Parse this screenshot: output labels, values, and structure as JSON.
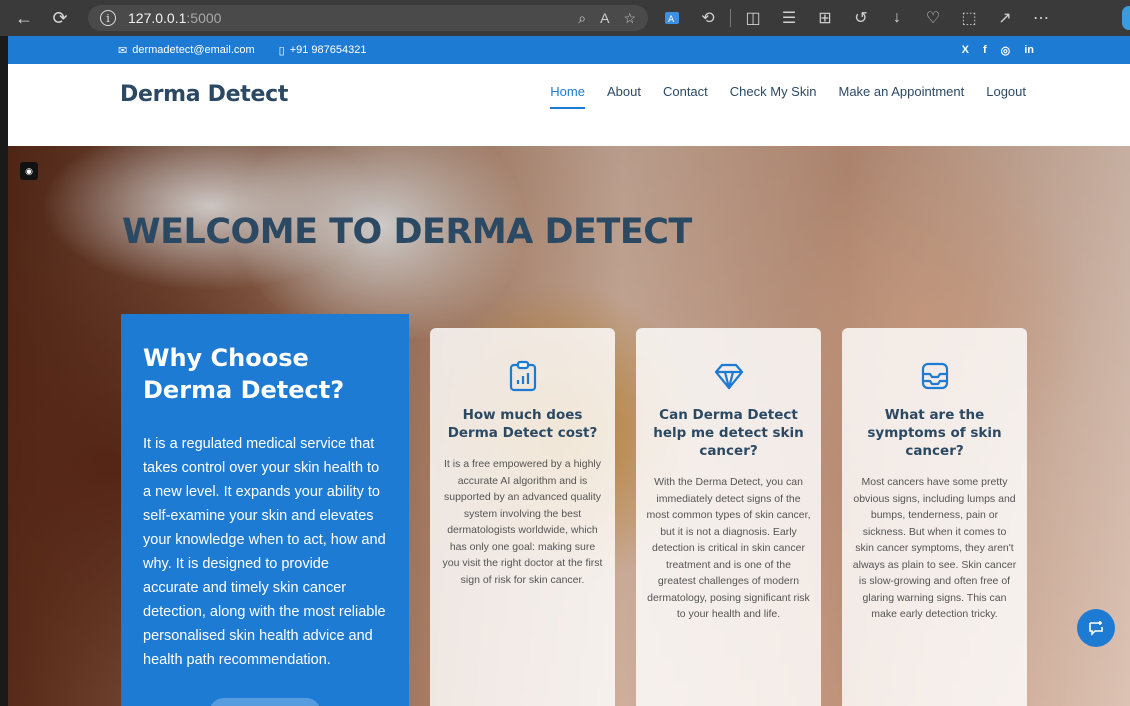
{
  "browser": {
    "url_host": "127.0.0.1",
    "url_port": ":5000",
    "icons": [
      "back-icon",
      "reload-icon",
      "info-icon",
      "zoom-icon",
      "read-aloud-icon",
      "favorite-icon",
      "translate-icon",
      "extensions-icon",
      "split-screen-icon",
      "favorites-bar-icon",
      "collections-icon",
      "history-icon",
      "download-icon",
      "health-icon",
      "screenshot-icon",
      "share-icon",
      "more-icon"
    ]
  },
  "topbar": {
    "email": "dermadetect@email.com",
    "phone": "+91 987654321",
    "socials": [
      "X",
      "f",
      "◎",
      "in"
    ]
  },
  "header": {
    "brand": "Derma Detect",
    "menu": [
      "Home",
      "About",
      "Contact",
      "Check My Skin",
      "Make an Appointment",
      "Logout"
    ]
  },
  "hero": {
    "welcome": "WELCOME TO DERMA DETECT",
    "why_title": "Why Choose Derma Detect?",
    "why_text": "It is a regulated medical service that takes control over your skin health to a new level. It expands your ability to self-examine your skin and elevates your knowledge when to act, how and why. It is designed to provide accurate and timely skin cancer detection, along with the most reliable personalised skin health advice and health path recommendation."
  },
  "cards": [
    {
      "icon": "clipboard-chart-icon",
      "title": "How much does Derma Detect cost?",
      "text": "It is a free empowered by a highly accurate AI algorithm and is supported by an advanced quality system involving the best dermatologists worldwide, which has only one goal: making sure you visit the right doctor at the first sign of risk for skin cancer."
    },
    {
      "icon": "diamond-icon",
      "title": "Can Derma Detect help me detect skin cancer?",
      "text": "With the Derma Detect, you can immediately detect signs of the most common types of skin cancer, but it is not a diagnosis. Early detection is critical in skin cancer treatment and is one of the greatest challenges of modern dermatology, posing significant risk to your health and life."
    },
    {
      "icon": "inbox-stack-icon",
      "title": "What are the symptoms of skin cancer?",
      "text": "Most cancers have some pretty obvious signs, including lumps and bumps, tenderness, pain or sickness. But when it comes to skin cancer symptoms, they aren't always as plain to see. Skin cancer is slow-growing and often free of glaring warning signs. This can make early detection tricky."
    }
  ],
  "colors": {
    "primary": "#1e7bd4",
    "heading": "#2c4964"
  }
}
